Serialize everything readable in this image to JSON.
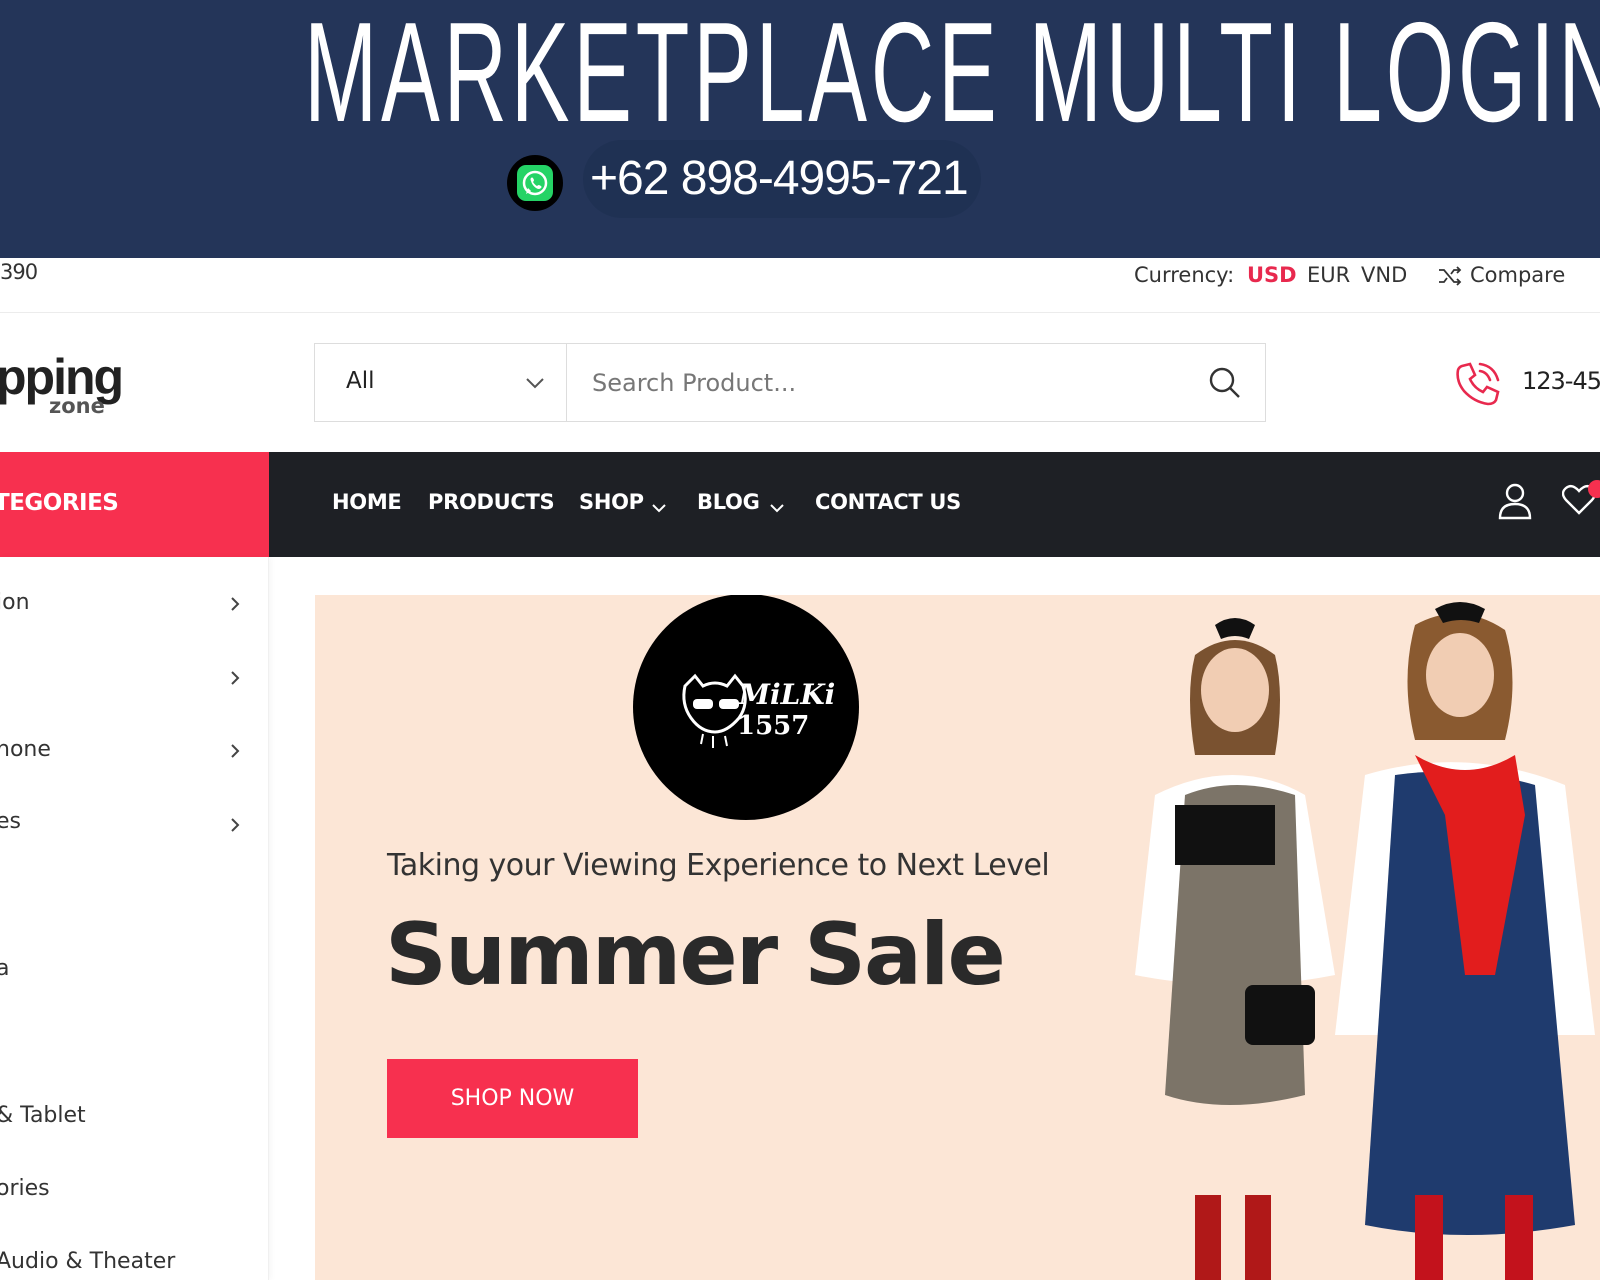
{
  "promo": {
    "title": "MARKETPLACE MULTI LOGIN",
    "phone": "+62 898-4995-721",
    "whatsapp_icon": "whatsapp-icon",
    "background": "#243559"
  },
  "topbar": {
    "phone_fragment": "390",
    "currency_label": "Currency:",
    "currencies": [
      "USD",
      "EUR",
      "VND"
    ],
    "active_currency": "USD",
    "compare_label": "Compare"
  },
  "header": {
    "logo_text": "pping",
    "logo_subtext": "zone",
    "search_category": "All",
    "search_placeholder": "Search Product...",
    "phone": "123-45"
  },
  "nav": {
    "categories_label": "TEGORIES",
    "items": [
      {
        "label": "HOME",
        "has_dropdown": false
      },
      {
        "label": "PRODUCTS",
        "has_dropdown": false
      },
      {
        "label": "SHOP",
        "has_dropdown": true
      },
      {
        "label": "BLOG",
        "has_dropdown": true
      },
      {
        "label": "CONTACT US",
        "has_dropdown": false
      }
    ]
  },
  "sidebar": {
    "items": [
      {
        "label": "ion",
        "has_submenu": true
      },
      {
        "label": "",
        "has_submenu": true
      },
      {
        "label": "hone",
        "has_submenu": true
      },
      {
        "label": "es",
        "has_submenu": true
      },
      {
        "label": "",
        "has_submenu": false
      },
      {
        "label": "a",
        "has_submenu": false
      },
      {
        "label": "",
        "has_submenu": false
      },
      {
        "label": "& Tablet",
        "has_submenu": false
      },
      {
        "label": "ories",
        "has_submenu": false
      },
      {
        "label": "Audio & Theater",
        "has_submenu": false
      }
    ]
  },
  "hero": {
    "logo_lines": [
      "MiLKi",
      "1557"
    ],
    "subtitle": "Taking your Viewing Experience to Next Level",
    "title": "Summer Sale",
    "button_label": "SHOP NOW"
  },
  "colors": {
    "accent": "#f7304f",
    "nav_bg": "#1e2025",
    "hero_bg": "#fce6d6",
    "promo_bg": "#243559"
  }
}
